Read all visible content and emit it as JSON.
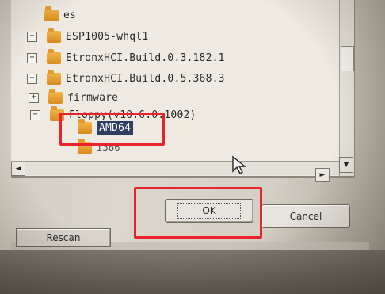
{
  "tree": {
    "items": [
      {
        "label": "es",
        "expander": "",
        "selected": false
      },
      {
        "label": "ESP1005-whql1",
        "expander": "+",
        "selected": false
      },
      {
        "label": "EtronxHCI.Build.0.3.182.1",
        "expander": "+",
        "selected": false
      },
      {
        "label": "EtronxHCI.Build.0.5.368.3",
        "expander": "+",
        "selected": false
      },
      {
        "label": "firmware",
        "expander": "+",
        "selected": false
      },
      {
        "label": "Floppy(v10.6.0.1002)",
        "expander": "−",
        "selected": false
      },
      {
        "label": "AMD64",
        "expander": "",
        "selected": true
      },
      {
        "label": "i386",
        "expander": "",
        "selected": false
      }
    ]
  },
  "scrollbars": {
    "left_arrow": "◄",
    "right_arrow": "►",
    "down_arrow": "▼"
  },
  "buttons": {
    "ok": "OK",
    "cancel": "Cancel",
    "rescan": "Rescan"
  },
  "colors": {
    "highlight": "#e8232b",
    "selection": "#2f3f63",
    "folder": "#e59b2a"
  }
}
